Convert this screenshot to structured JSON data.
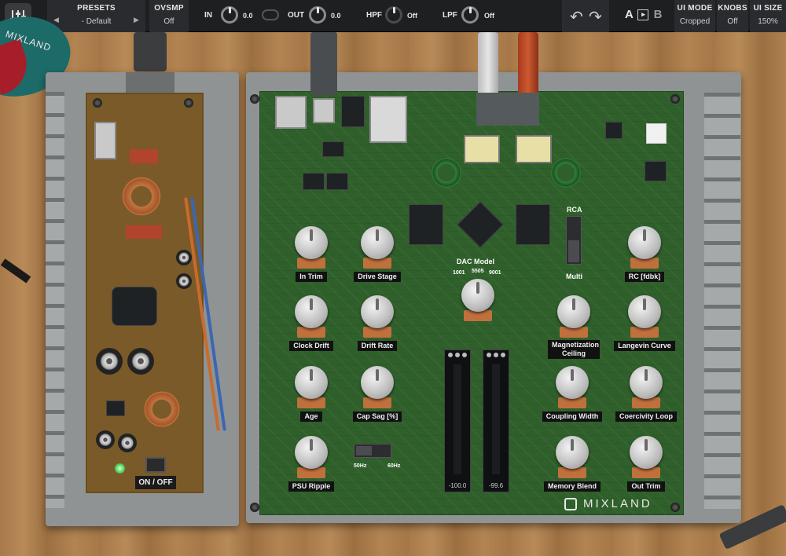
{
  "toolbar": {
    "presets": {
      "label": "PRESETS",
      "value": "- Default",
      "prev_icon": "triangle-left",
      "next_icon": "triangle-right"
    },
    "ovsmp": {
      "label": "OVSMP",
      "value": "Off"
    },
    "in": {
      "label": "IN",
      "value": "0.0"
    },
    "out": {
      "label": "OUT",
      "value": "0.0"
    },
    "hpf": {
      "label": "HPF",
      "value": "Off"
    },
    "lpf": {
      "label": "LPF",
      "value": "Off"
    },
    "ab": {
      "a": "A",
      "b": "B",
      "copy_icon": "copy-arrow"
    },
    "ui_mode": {
      "label": "UI MODE",
      "value": "Cropped"
    },
    "knobs": {
      "label": "KNOBS",
      "value": "Off"
    },
    "ui_size": {
      "label": "UI SIZE",
      "value": "150%"
    }
  },
  "hardware": {
    "corner_logo": "MIXLAND",
    "power_switch": "ON / OFF",
    "brand": "MIXLAND",
    "knobs_left": [
      {
        "label": "In Trim"
      },
      {
        "label": "Drive Stage"
      },
      {
        "label": "Clock Drift"
      },
      {
        "label": "Drift Rate"
      },
      {
        "label": "Age"
      },
      {
        "label": "Cap Sag [%]"
      },
      {
        "label": "PSU Ripple"
      }
    ],
    "freq_switch": {
      "left": "50Hz",
      "right": "60Hz"
    },
    "dac": {
      "label": "DAC Model",
      "options": [
        "1001",
        "5505",
        "9001"
      ]
    },
    "meters": [
      {
        "value": "-100.0"
      },
      {
        "value": "-99.6"
      }
    ],
    "rca_switch": {
      "top": "RCA",
      "bottom": "Multi"
    },
    "knobs_right": [
      {
        "label": "RC [fdbk]"
      },
      {
        "label": "Magnetization Ceiling"
      },
      {
        "label": "Langevin Curve"
      },
      {
        "label": "Coupling Width"
      },
      {
        "label": "Coercivity Loop"
      },
      {
        "label": "Memory Blend"
      },
      {
        "label": "Out Trim"
      }
    ]
  },
  "colors": {
    "toolbar_bg": "#1e1f21",
    "pcb_green": "#2f5f2a",
    "label_bg": "#111111",
    "led_green": "#4ccf56"
  }
}
